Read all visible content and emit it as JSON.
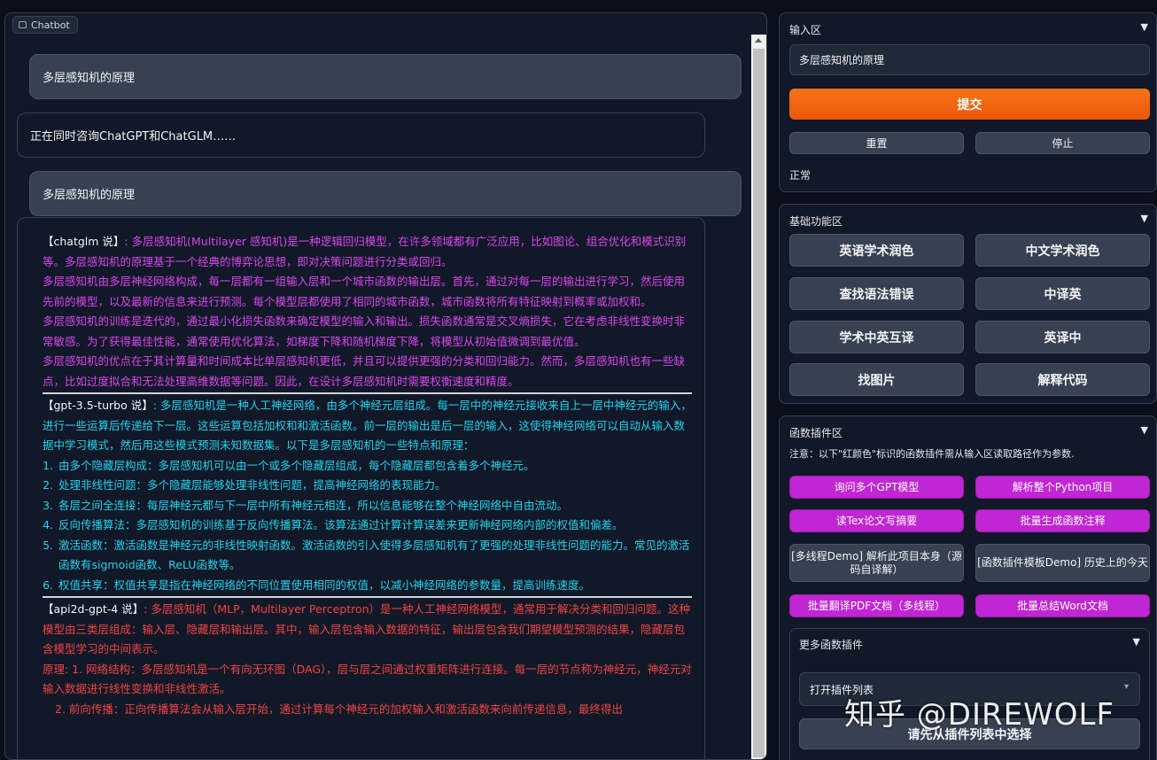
{
  "chatbot": {
    "label": "Chatbot",
    "messages": {
      "q1": "多层感知机的原理",
      "a1": "正在同时咨询ChatGPT和ChatGLM……",
      "q2": "多层感知机的原理",
      "chatglm_tag": "【chatglm 说】",
      "chatglm_p1": ": 多层感知机(Multilayer 感知机)是一种逻辑回归模型，在许多领域都有广泛应用，比如图论、组合优化和模式识别等。多层感知机的原理基于一个经典的博弈论思想，即对决策问题进行分类或回归。",
      "chatglm_p2": "多层感知机由多层神经网络构成，每一层都有一组输入层和一个城市函数的输出层。首先，通过对每一层的输出进行学习，然后使用先前的模型，以及最新的信息来进行预测。每个模型层都使用了相同的城市函数，城市函数将所有特征映射到概率或加权和。",
      "chatglm_p3": "多层感知机的训练是迭代的，通过最小化损失函数来确定模型的输入和输出。损失函数通常是交叉熵损失，它在考虑非线性变换时非常敏感。为了获得最佳性能，通常使用优化算法，如梯度下降和随机梯度下降，将模型从初始值微调到最优值。",
      "chatglm_p4": "多层感知机的优点在于其计算量和时间成本比单层感知机更低，并且可以提供更强的分类和回归能力。然而，多层感知机也有一些缺点，比如过度拟合和无法处理高维数据等问题。因此，在设计多层感知机时需要权衡速度和精度。",
      "gpt_tag": "【gpt-3.5-turbo 说】",
      "gpt_intro": ": 多层感知机是一种人工神经网络，由多个神经元层组成。每一层中的神经元接收来自上一层中神经元的输入，进行一些运算后传递给下一层。这些运算包括加权和和激活函数。前一层的输出是后一层的输入，这使得神经网络可以自动从输入数据中学习模式，然后用这些模式预测未知数据集。以下是多层感知机的一些特点和原理：",
      "gpt_points": [
        "由多个隐藏层构成：多层感知机可以由一个或多个隐藏层组成，每个隐藏层都包含着多个神经元。",
        "处理非线性问题：多个隐藏层能够处理非线性问题，提高神经网络的表现能力。",
        "各层之间全连接：每层神经元都与下一层中所有神经元相连，所以信息能够在整个神经网络中自由流动。",
        "反向传播算法：多层感知机的训练基于反向传播算法。该算法通过计算计算误差来更新神经网络内部的权值和偏差。",
        "激活函数：激活函数是神经元的非线性映射函数。激活函数的引入使得多层感知机有了更强的处理非线性问题的能力。常见的激活函数有sigmoid函数、ReLU函数等。",
        "权值共享：权值共享是指在神经网络的不同位置使用相同的权值，以减小神经网络的参数量，提高训练速度。"
      ],
      "api2d_tag": "【api2d-gpt-4 说】",
      "api2d_p1": ": 多层感知机（MLP，Multilayer Perceptron）是一种人工神经网络模型，通常用于解决分类和回归问题。这种模型由三类层组成：输入层、隐藏层和输出层。其中，输入层包含输入数据的特征，输出层包含我们期望模型预测的结果，隐藏层包含模型学习的中间表示。",
      "api2d_p2": "原理: 1. 网络结构：多层感知机是一个有向无环图（DAG），层与层之间通过权重矩阵进行连接。每一层的节点称为神经元，神经元对输入数据进行线性变换和非线性激活。",
      "api2d_p3": "2. 前向传播：正向传播算法会从输入层开始，通过计算每个神经元的加权输入和激活函数来向前传递信息，最终得出"
    }
  },
  "input_section": {
    "title": "输入区",
    "toggle": "▼",
    "input_value": "多层感知机的原理",
    "submit_label": "提交",
    "reset_label": "重置",
    "stop_label": "停止",
    "status": "正常"
  },
  "basic_section": {
    "title": "基础功能区",
    "toggle": "▼",
    "buttons": [
      "英语学术润色",
      "中文学术润色",
      "查找语法错误",
      "中译英",
      "学术中英互译",
      "英译中",
      "找图片",
      "解释代码"
    ]
  },
  "plugin_section": {
    "title": "函数插件区",
    "toggle": "▼",
    "note": "注意：以下\"红颜色\"标识的函数插件需从输入区读取路径作为参数.",
    "buttons": [
      "询问多个GPT模型",
      "解析整个Python项目",
      "读Tex论文写摘要",
      "批量生成函数注释",
      "[多线程Demo] 解析此项目本身（源码自译解）",
      "[函数插件模板Demo] 历史上的今天",
      "批量翻译PDF文档（多线程）",
      "批量总结Word文档"
    ],
    "more": {
      "title": "更多函数插件",
      "toggle": "▼",
      "dropdown_value": "打开插件列表",
      "select_label": "请先从插件列表中选择"
    }
  },
  "watermark": "知乎 @DIREWOLF",
  "colors": {
    "accent": "#f97316",
    "plugin_purple": "#c026d3",
    "chatglm_text": "#d946ef",
    "gpt_text": "#22d3ee",
    "api2d_text": "#ef4444"
  }
}
